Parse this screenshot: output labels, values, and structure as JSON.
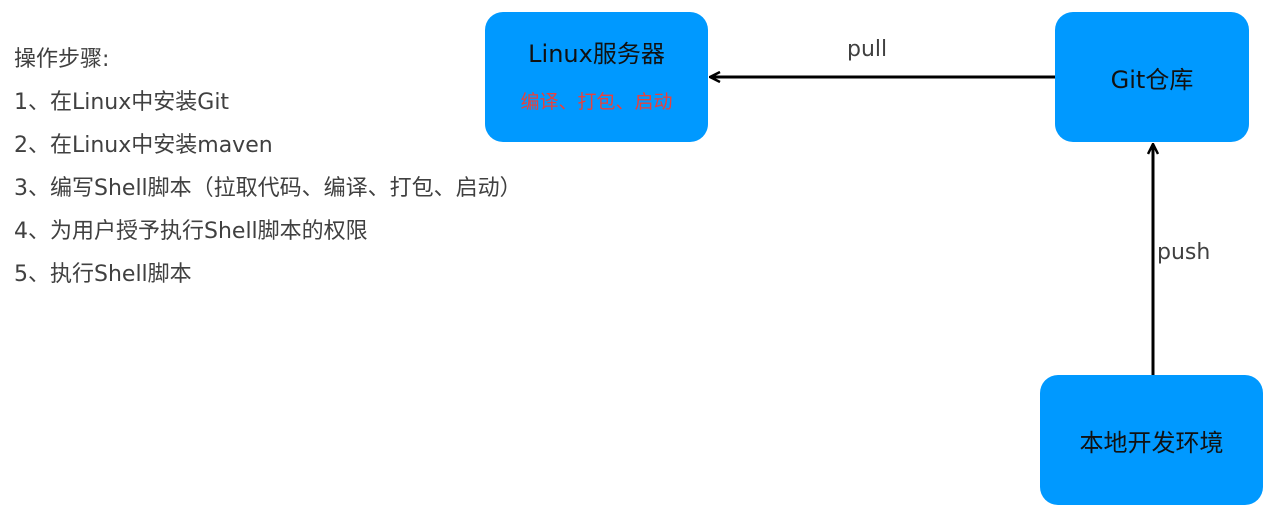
{
  "steps": {
    "heading": "操作步骤:",
    "items": [
      "1、在Linux中安装Git",
      "2、在Linux中安装maven",
      "3、编写Shell脚本（拉取代码、编译、打包、启动）",
      "4、为用户授予执行Shell脚本的权限",
      "5、执行Shell脚本"
    ]
  },
  "nodes": {
    "linux": {
      "title": "Linux服务器",
      "subtitle": "编译、打包、启动"
    },
    "git": {
      "title": "Git仓库"
    },
    "local": {
      "title": "本地开发环境"
    }
  },
  "edges": {
    "pull": "pull",
    "push": "push"
  },
  "colors": {
    "box_fill": "#0099ff",
    "subtitle_text": "#e8413c",
    "arrow": "#000000"
  }
}
